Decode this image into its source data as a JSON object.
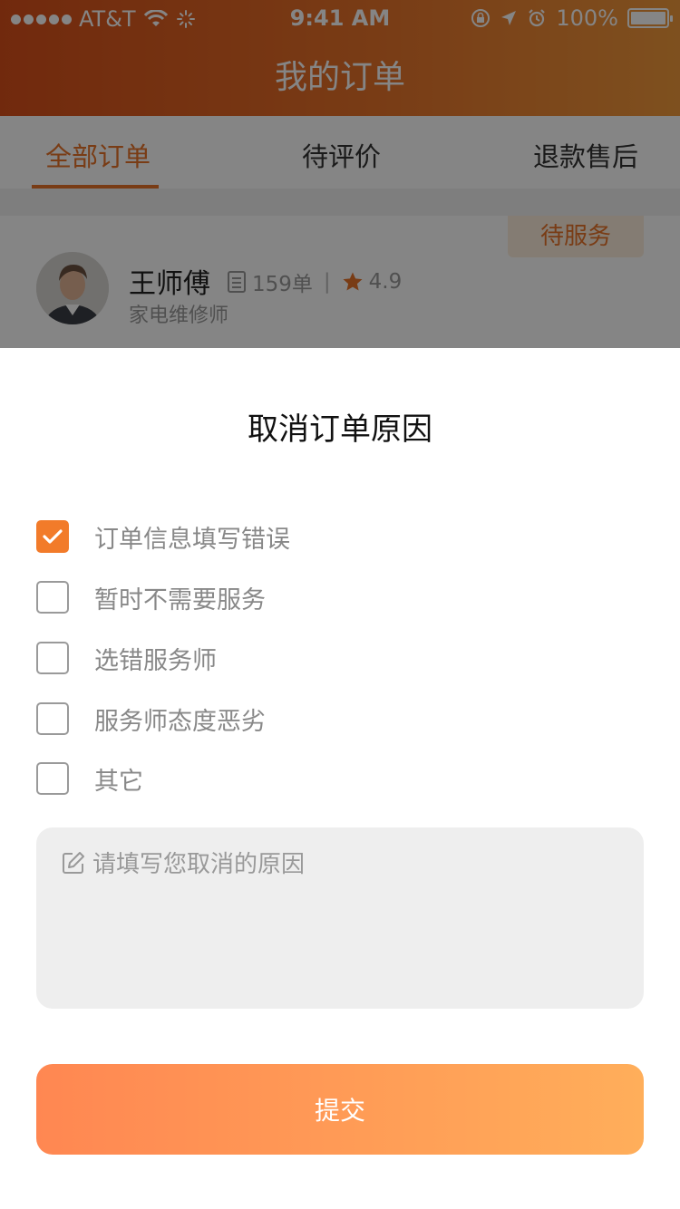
{
  "status_bar": {
    "carrier": "AT&T",
    "time": "9:41 AM",
    "battery": "100%"
  },
  "nav": {
    "title": "我的订单"
  },
  "tabs": [
    {
      "label": "全部订单",
      "active": true
    },
    {
      "label": "待评价",
      "active": false
    },
    {
      "label": "退款售后",
      "active": false
    }
  ],
  "order": {
    "status": "待服务",
    "worker_name": "王师傅",
    "order_count": "159单",
    "rating": "4.9",
    "job": "家电维修师"
  },
  "sheet": {
    "title": "取消订单原因",
    "reasons": [
      {
        "label": "订单信息填写错误",
        "checked": true
      },
      {
        "label": "暂时不需要服务",
        "checked": false
      },
      {
        "label": "选错服务师",
        "checked": false
      },
      {
        "label": "服务师态度恶劣",
        "checked": false
      },
      {
        "label": "其它",
        "checked": false
      }
    ],
    "textarea_placeholder": "请填写您取消的原因",
    "submit_label": "提交"
  },
  "colors": {
    "accent": "#f27b2a",
    "tab_active": "#e8732a",
    "submit_start": "#ff8752",
    "submit_end": "#ffae5a"
  },
  "icons": [
    "wifi-icon",
    "location-icon",
    "alarm-icon",
    "battery-icon",
    "order-list-icon",
    "star-icon",
    "check-icon",
    "edit-icon"
  ]
}
